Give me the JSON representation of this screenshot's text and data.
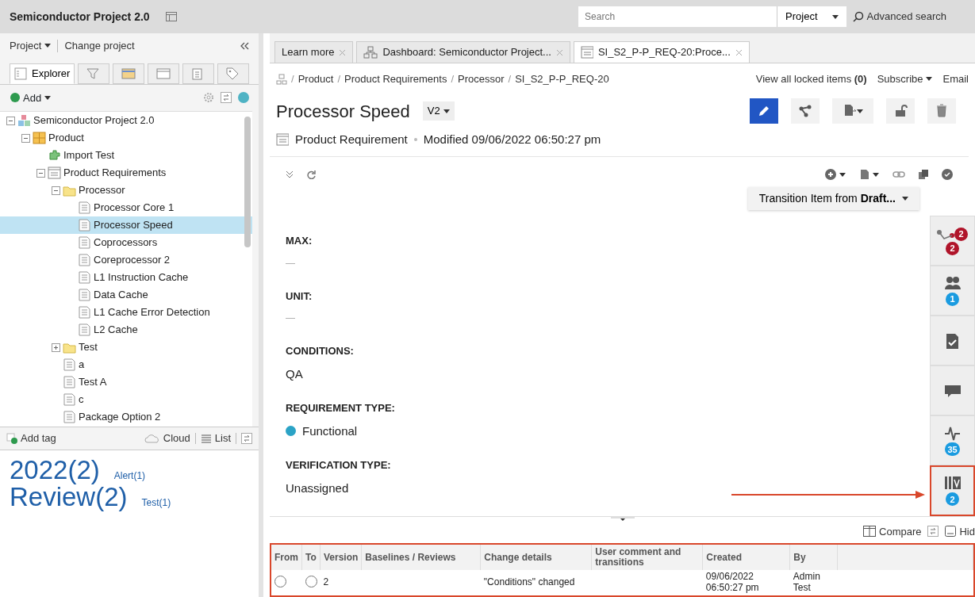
{
  "app_title": "Semiconductor Project 2.0",
  "search": {
    "placeholder": "Search",
    "scope": "Project",
    "advanced": "Advanced search"
  },
  "sidebar": {
    "project_menu": "Project",
    "change_project": "Change project",
    "tabs": [
      {
        "kind": "explorer",
        "label": "Explorer",
        "selected": true
      },
      {
        "kind": "filter",
        "selected": false
      },
      {
        "kind": "calendar",
        "selected": false
      },
      {
        "kind": "window",
        "selected": false
      },
      {
        "kind": "clipboard",
        "selected": false
      },
      {
        "kind": "tag",
        "selected": false
      }
    ],
    "add_button": "Add",
    "tree": [
      {
        "kind": "project",
        "label": "Semiconductor Project 2.0",
        "selected": false,
        "expanded": true,
        "children": [
          {
            "kind": "product",
            "label": "Product",
            "selected": false,
            "expanded": true,
            "children": [
              {
                "kind": "import",
                "label": "Import Test",
                "selected": false
              },
              {
                "kind": "requirements",
                "label": "Product Requirements",
                "selected": false,
                "expanded": true,
                "children": [
                  {
                    "kind": "folder",
                    "label": "Processor",
                    "selected": false,
                    "expanded": true,
                    "children": [
                      {
                        "kind": "document",
                        "label": "Processor Core 1",
                        "selected": false
                      },
                      {
                        "kind": "document",
                        "label": "Processor Speed",
                        "selected": true
                      },
                      {
                        "kind": "document",
                        "label": "Coprocessors",
                        "selected": false
                      },
                      {
                        "kind": "document",
                        "label": "Coreprocessor 2",
                        "selected": false
                      },
                      {
                        "kind": "document",
                        "label": "L1 Instruction Cache",
                        "selected": false
                      },
                      {
                        "kind": "document",
                        "label": "Data Cache",
                        "selected": false
                      },
                      {
                        "kind": "document",
                        "label": "L1 Cache Error Detection",
                        "selected": false
                      },
                      {
                        "kind": "document",
                        "label": "L2 Cache",
                        "selected": false
                      }
                    ]
                  },
                  {
                    "kind": "folder",
                    "label": "Test",
                    "selected": false,
                    "expanded": false
                  },
                  {
                    "kind": "document",
                    "label": "a",
                    "selected": false
                  },
                  {
                    "kind": "document",
                    "label": "Test A",
                    "selected": false
                  },
                  {
                    "kind": "document",
                    "label": "c",
                    "selected": false
                  },
                  {
                    "kind": "document",
                    "label": "Package Option 2",
                    "selected": false
                  }
                ]
              }
            ]
          }
        ]
      }
    ],
    "tag_toolbar": {
      "add_tag": "Add tag",
      "cloud": "Cloud",
      "list": "List"
    },
    "tag_cloud": [
      {
        "label": "2022(2)",
        "kind": "major"
      },
      {
        "label": "Alert(1)",
        "kind": "minor"
      },
      {
        "label": "Review(2)",
        "kind": "major"
      },
      {
        "label": "Test(1)",
        "kind": "minor"
      }
    ]
  },
  "tabs": [
    {
      "kind": "plain",
      "label": "Learn more",
      "selected": false
    },
    {
      "kind": "dashboard",
      "label": "Dashboard: Semiconductor Project...",
      "selected": false
    },
    {
      "kind": "item",
      "label": "SI_S2_P-P_REQ-20:Proce...",
      "selected": true
    }
  ],
  "breadcrumb": [
    "Product",
    "Product Requirements",
    "Processor",
    "SI_S2_P-P_REQ-20"
  ],
  "breadcrumb_separator": "/",
  "header_links": {
    "locked": "View all locked items **(0)**",
    "subscribe": "Subscribe",
    "email": "Email"
  },
  "item": {
    "title": "Processor Speed",
    "version": "V2",
    "type": "Product Requirement",
    "modified": "Modified 09/06/2022 06:50:27 pm"
  },
  "transition": "Transition Item from **Draft...**",
  "fields": [
    {
      "label": "MAX:",
      "value": "—"
    },
    {
      "label": "UNIT:",
      "value": "—"
    },
    {
      "label": "CONDITIONS:",
      "value": "QA"
    },
    {
      "label": "REQUIREMENT TYPE:",
      "value": "Functional",
      "color": "#2ba3c6"
    },
    {
      "label": "VERIFICATION TYPE:",
      "value": "Unassigned"
    }
  ],
  "side_widgets": [
    {
      "kind": "relationships",
      "badges": [
        "2",
        "2"
      ],
      "highlighted": false
    },
    {
      "kind": "people",
      "badges": [
        "1"
      ],
      "highlighted": false
    },
    {
      "kind": "review",
      "highlighted": false
    },
    {
      "kind": "comments",
      "highlighted": false
    },
    {
      "kind": "activity",
      "badges": [
        "35"
      ],
      "highlighted": false
    },
    {
      "kind": "versions",
      "badges": [
        "2"
      ],
      "highlighted": true,
      "pointer_arrow": true
    }
  ],
  "history_toolbar": {
    "compare": "Compare",
    "hide": "Hid"
  },
  "history_table": {
    "highlighted": true,
    "columns": [
      "From",
      "To",
      "Version",
      "Baselines / Reviews",
      "Change details",
      "User comment and transitions",
      "Created",
      "By"
    ],
    "rows": [
      {
        "from_selected": false,
        "to_selected": false,
        "version": "2",
        "change": "\"Conditions\" changed",
        "created": "09/06/2022 06:50:27 pm",
        "by": "Admin Test"
      }
    ]
  }
}
